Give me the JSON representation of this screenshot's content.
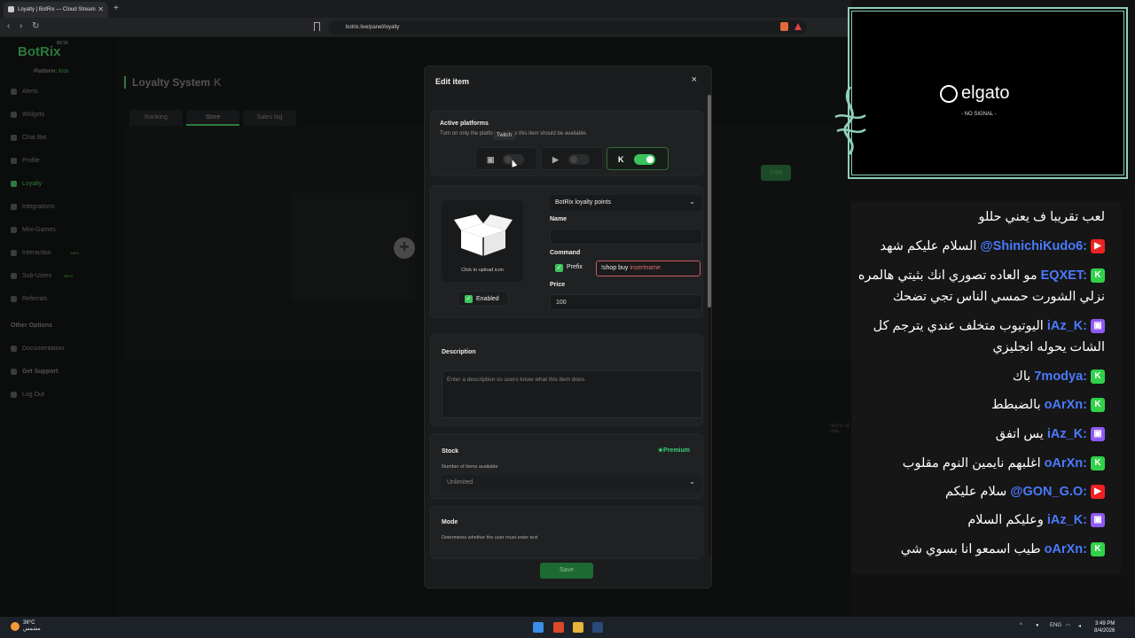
{
  "browser": {
    "tab_title": "Loyalty | BotRix — Cloud Stream",
    "url": "botrix.live/panel/loyalty"
  },
  "sidebar": {
    "logo": "BotRix",
    "beta": "BETA",
    "platform_label": "Platform:",
    "platform_value": "Kick",
    "items": [
      {
        "label": "Alerts"
      },
      {
        "label": "Widgets"
      },
      {
        "label": "Chat Bot"
      },
      {
        "label": "Profile"
      },
      {
        "label": "Loyalty"
      },
      {
        "label": "Integrations"
      },
      {
        "label": "Mini-Games"
      },
      {
        "label": "Interaction",
        "badge": "NEW"
      },
      {
        "label": "Sub-Users",
        "badge": "BETA"
      },
      {
        "label": "Referrals"
      }
    ],
    "other_heading": "Other Options",
    "other_items": [
      {
        "label": "Documentation"
      },
      {
        "label": "Get Support"
      },
      {
        "label": "Log Out"
      }
    ]
  },
  "page": {
    "title": "Loyalty System",
    "tabs": [
      "Ranking",
      "Store",
      "Sales log"
    ],
    "copy_label": "Copy",
    "tos_text": "terms of use."
  },
  "modal": {
    "title": "Edit item",
    "close": "×",
    "platforms_title": "Active platforms",
    "platforms_sub": "Turn on only the platforms where this item should be available.",
    "tooltip": "Twitch",
    "currency": "BotRix loyalty points",
    "upload_label": "Click to upload icon",
    "enabled_label": "Enabled",
    "name_label": "Name",
    "name_value": "",
    "command_label": "Command",
    "prefix_label": "Prefix",
    "command_prefix": "!shop buy ",
    "command_hint": "insertname",
    "price_label": "Price",
    "price_value": "100",
    "description_label": "Description",
    "description_placeholder": "Enter a description so users know what this item does.",
    "stock_label": "Stock",
    "premium_label": "Premium",
    "stock_sub": "Number of items available",
    "stock_value": "Unlimited",
    "mode_label": "Mode",
    "mode_sub": "Determines whether the user must enter text",
    "save_label": "Save"
  },
  "elgato": {
    "logo": "elgato",
    "status": "- NO SIGNAL -"
  },
  "chat": [
    {
      "platform": "none",
      "user": "",
      "text": "لعب تقريبا ف يعني حللو"
    },
    {
      "platform": "youtube",
      "user": "@ShinichiKudo6:",
      "text": "السلام عليكم شهد"
    },
    {
      "platform": "kick",
      "user": "EQXET:",
      "text": "مو العاده تصوري انك بثيتي هالمره"
    },
    {
      "platform": "none",
      "user": "",
      "text": "نزلي الشورت حمسي الناس تجي تضحك"
    },
    {
      "platform": "twitch",
      "user": "iAz_K:",
      "text": "اليوتيوب متخلف عندي يترجم كل"
    },
    {
      "platform": "none",
      "user": "",
      "text": "الشات يحوله انجليزي"
    },
    {
      "platform": "kick",
      "user": "7modya:",
      "text": "باك"
    },
    {
      "platform": "kick",
      "user": "oArXn:",
      "text": "بالضبطط"
    },
    {
      "platform": "twitch",
      "user": "iAz_K:",
      "text": "يس اتفق"
    },
    {
      "platform": "kick",
      "user": "oArXn:",
      "text": "اغلبهم نايمين النوم مقلوب"
    },
    {
      "platform": "youtube",
      "user": "@GON_G.O:",
      "text": "سلام عليكم"
    },
    {
      "platform": "twitch",
      "user": "iAz_K:",
      "text": "وعليكم السلام"
    },
    {
      "platform": "kick",
      "user": "oArXn:",
      "text": "طيب اسمعو انا بسوي شي"
    }
  ],
  "taskbar": {
    "temp": "38°C",
    "weather_text": "مشمس",
    "lang": "ENG",
    "time": "3:49 PM",
    "date": "8/4/2026"
  },
  "colors": {
    "accent": "#3bc45c",
    "kick": "#31d14a",
    "twitch": "#8f5af2",
    "youtube": "#ee2222",
    "elgato_border": "#8fd0b8"
  }
}
